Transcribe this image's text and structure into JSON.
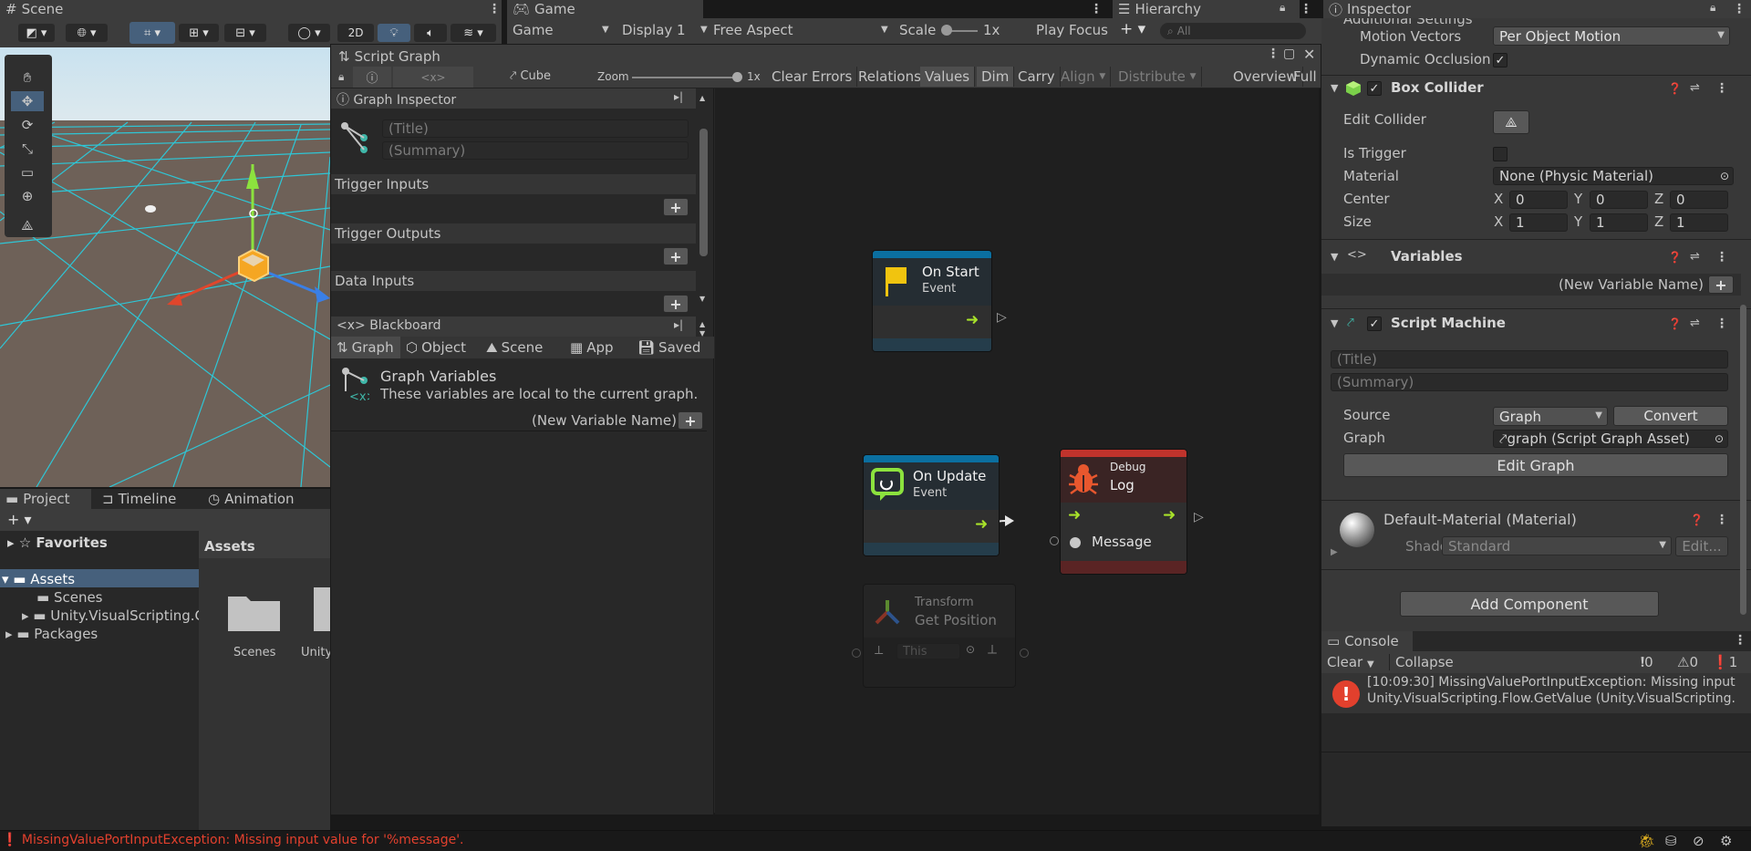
{
  "scene": {
    "tab": "Scene"
  },
  "game": {
    "tab": "Game",
    "view": "Game",
    "display": "Display 1",
    "aspect": "Free Aspect",
    "scale_label": "Scale",
    "scale_value": "1x",
    "play_focus": "Play Focus"
  },
  "hierarchy": {
    "tab": "Hierarchy",
    "search_placeholder": "All"
  },
  "script_graph": {
    "tab": "Script Graph",
    "breadcrumb": "Cube",
    "zoom_label": "Zoom",
    "zoom_value": "1x",
    "toolbar": [
      "Clear Errors",
      "Relations",
      "Values",
      "Dim",
      "Carry",
      "Align",
      "Distribute",
      "Overview",
      "Full Sc"
    ],
    "graph_inspector": {
      "header": "Graph Inspector",
      "title_placeholder": "(Title)",
      "summary_placeholder": "(Summary)",
      "sections": [
        "Trigger Inputs",
        "Trigger Outputs",
        "Data Inputs"
      ]
    },
    "blackboard": {
      "header": "Blackboard",
      "tabs": [
        "Graph",
        "Object",
        "Scene",
        "App",
        "Saved"
      ],
      "info_title": "Graph Variables",
      "info_text": "These variables are local to the current graph.",
      "new_var_placeholder": "(New Variable Name)"
    },
    "nodes": {
      "on_start": {
        "title": "On Start",
        "subtitle": "Event"
      },
      "on_update": {
        "title": "On Update",
        "subtitle": "Event"
      },
      "debug_log": {
        "category": "Debug",
        "title": "Log",
        "port": "Message"
      },
      "get_position": {
        "category": "Transform",
        "title": "Get Position",
        "input": "This"
      }
    }
  },
  "project": {
    "tabs": [
      "Project",
      "Timeline",
      "Animation"
    ],
    "tree": [
      "Favorites",
      "Assets",
      "Scenes",
      "Unity.VisualScripting.C",
      "Packages"
    ],
    "assets_header": "Assets",
    "folders": [
      "Scenes",
      "Unity"
    ]
  },
  "inspector": {
    "tab": "Inspector",
    "partial_header": "Additional Settings",
    "motion_vectors_label": "Motion Vectors",
    "motion_vectors_value": "Per Object Motion",
    "dynamic_occlusion_label": "Dynamic Occlusion",
    "box_collider": {
      "title": "Box Collider",
      "edit_collider": "Edit Collider",
      "is_trigger": "Is Trigger",
      "material_label": "Material",
      "material_value": "None (Physic Material)",
      "center_label": "Center",
      "center": {
        "x": "0",
        "y": "0",
        "z": "0"
      },
      "size_label": "Size",
      "size": {
        "x": "1",
        "y": "1",
        "z": "1"
      }
    },
    "variables": {
      "title": "Variables",
      "new_var_placeholder": "(New Variable Name)"
    },
    "script_machine": {
      "title": "Script Machine",
      "title_placeholder": "(Title)",
      "summary_placeholder": "(Summary)",
      "source_label": "Source",
      "source_value": "Graph",
      "convert": "Convert",
      "graph_label": "Graph",
      "graph_value": "graph (Script Graph Asset)",
      "edit_graph": "Edit Graph"
    },
    "material": {
      "name": "Default-Material (Material)",
      "shader_label": "Shader",
      "shader_value": "Standard",
      "edit": "Edit..."
    },
    "add_component": "Add Component"
  },
  "console": {
    "tab": "Console",
    "clear": "Clear",
    "collapse": "Collapse",
    "counts": {
      "info": "0",
      "warn": "0",
      "error": "1"
    },
    "message_line1": "[10:09:30] MissingValuePortInputException: Missing input",
    "message_line2": "Unity.VisualScripting.Flow.GetValue (Unity.VisualScripting."
  },
  "status_bar": {
    "message": "MissingValuePortInputException: Missing input value for '%message'."
  },
  "colors": {
    "accent_blue": "#0b6fa0",
    "event_header": "#1a8cbf",
    "debug_header": "#c0332c",
    "error_red": "#e2402d",
    "flow_green": "#a8e22a",
    "selection": "#46607c"
  }
}
